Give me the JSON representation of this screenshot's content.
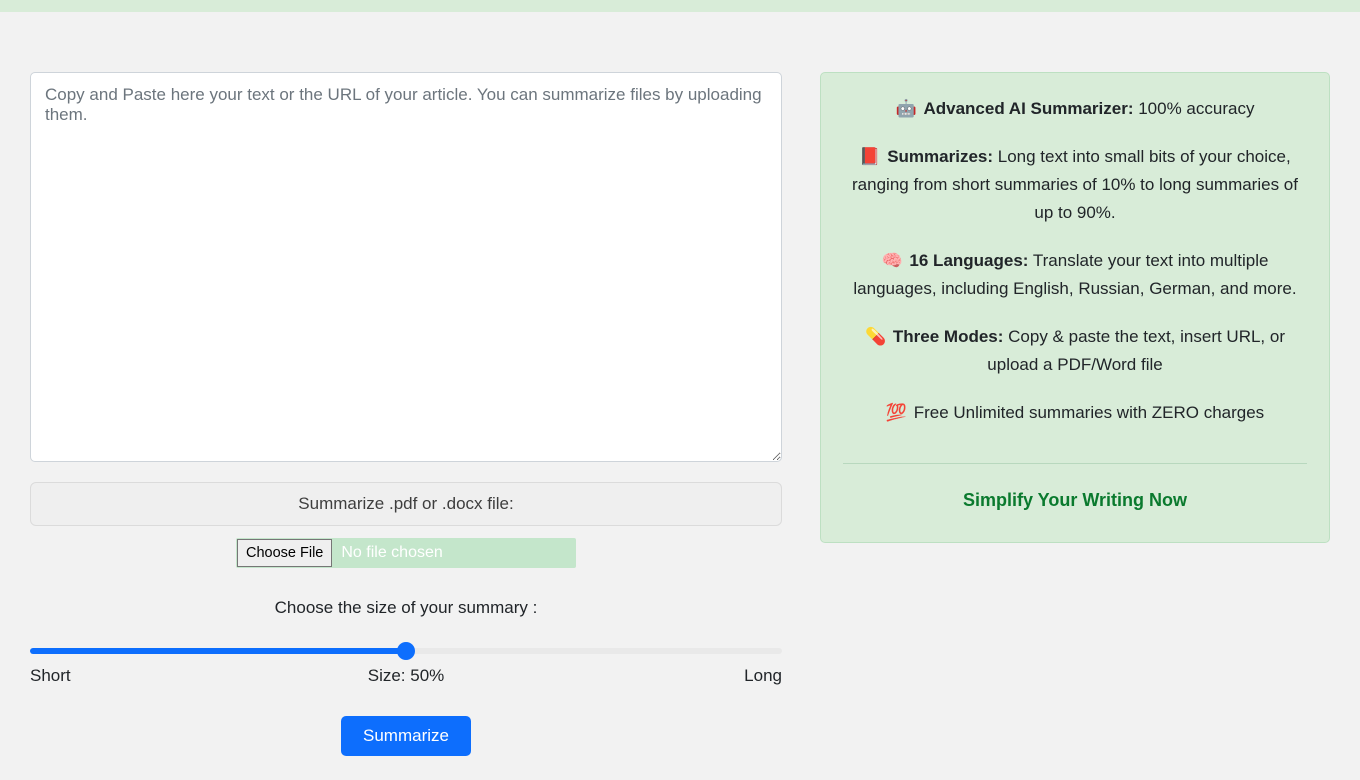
{
  "main": {
    "textarea_placeholder": "Copy and Paste here your text or the URL of your article. You can summarize files by uploading them.",
    "file_box_label": "Summarize .pdf or .docx file:",
    "choose_file_button": "Choose File",
    "no_file_text": "No file chosen",
    "size_prompt": "Choose the size of your summary :",
    "slider": {
      "min": 10,
      "max": 90,
      "value": 50,
      "left_label": "Short",
      "center_label": "Size: 50%",
      "right_label": "Long"
    },
    "summarize_button": "Summarize"
  },
  "promo": {
    "items": [
      {
        "icon": "🤖",
        "bold": "Advanced AI Summarizer:",
        "rest": " 100% accuracy"
      },
      {
        "icon": "📕",
        "bold": "Summarizes:",
        "rest": " Long text into small bits of your choice, ranging from short summaries of 10% to long summaries of up to 90%."
      },
      {
        "icon": "🧠",
        "bold": "16 Languages:",
        "rest": " Translate your text into multiple languages, including English, Russian, German, and more."
      },
      {
        "icon": "💊",
        "bold": "Three Modes:",
        "rest": " Copy & paste the text, insert URL, or upload a PDF/Word file"
      },
      {
        "icon": "💯",
        "bold": "",
        "rest": " Free Unlimited summaries with ZERO charges"
      }
    ],
    "cta": "Simplify Your Writing Now"
  }
}
